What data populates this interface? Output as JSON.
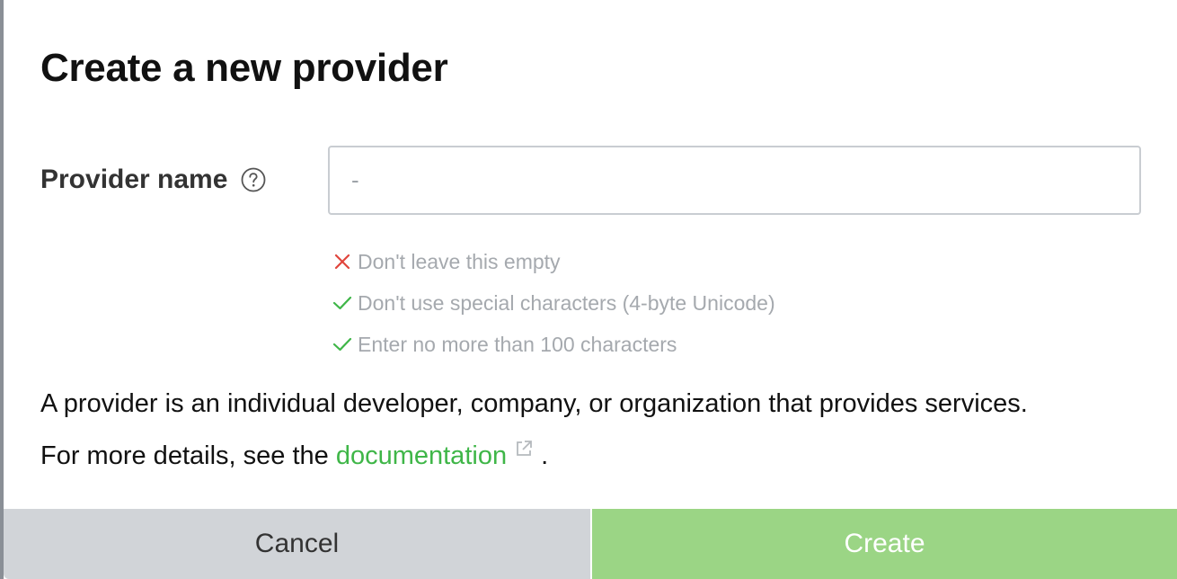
{
  "dialog": {
    "title": "Create a new provider"
  },
  "form": {
    "field_label": "Provider name",
    "input_value": "",
    "input_placeholder": "-"
  },
  "validation": {
    "rules": [
      {
        "status": "fail",
        "text": "Don't leave this empty",
        "color": "#e0453c"
      },
      {
        "status": "pass",
        "text": "Don't use special characters (4-byte Unicode)",
        "color": "#3fb648"
      },
      {
        "status": "pass",
        "text": "Enter no more than 100 characters",
        "color": "#3fb648"
      }
    ]
  },
  "description": {
    "line1": "A provider is an individual developer, company, or organization that provides services.",
    "line2_prefix": "For more details, see the ",
    "link_text": "documentation",
    "line2_suffix": " ."
  },
  "buttons": {
    "cancel_label": "Cancel",
    "create_label": "Create"
  },
  "colors": {
    "accent": "#3fb648",
    "create_disabled": "#9bd585",
    "cancel_bg": "#d1d4d8"
  },
  "icons": {
    "help": "question-circle-icon",
    "fail": "x-mark-icon",
    "pass": "check-mark-icon",
    "external": "external-link-icon"
  }
}
